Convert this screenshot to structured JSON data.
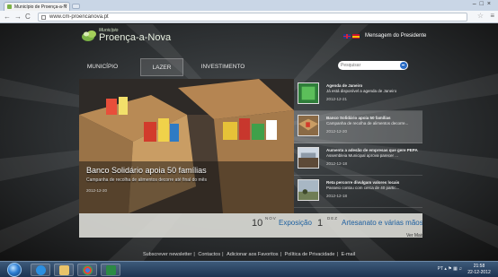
{
  "browser": {
    "tab_title": "Município de Proença-a-N",
    "tab_close": "×",
    "url": "www.cm-proencanova.pt",
    "back": "←",
    "forward": "→",
    "reload": "C"
  },
  "header": {
    "logo_small": "Município",
    "logo_name": "Proença-a-Nova",
    "president_link": "Mensagem do Presidente"
  },
  "nav": [
    {
      "label": "MUNICÍPIO"
    },
    {
      "label": "LAZER"
    },
    {
      "label": "INVESTIMENTO"
    }
  ],
  "search": {
    "placeholder": "Pesquisar"
  },
  "hero": {
    "title": "Banco Solidário apoia 50 famílias",
    "description": "Campanha de recolha de alimentos decorre até final do mês",
    "date": "2012-12-20"
  },
  "news": [
    {
      "title": "Agenda de Janeiro",
      "subtitle": "Já está disponível a agenda de Janeiro",
      "date": "2012-12-21",
      "active": false
    },
    {
      "title": "Banco Solidário apoia 50 famílias",
      "subtitle": "Campanha de recolha de alimentos decorre...",
      "date": "2012-12-20",
      "active": true
    },
    {
      "title": "Aumenta a adesão de empresas que gere PEPA",
      "subtitle": "Assembleia Municipal aprova parecer ...",
      "date": "2012-12-18",
      "active": false
    },
    {
      "title": "Reta percorre divulgam valores locais",
      "subtitle": "Passeio contou com cerca de 40 partic...",
      "date": "2012-12-18",
      "active": false
    }
  ],
  "agenda": [
    {
      "day": "10",
      "month": "NOV",
      "title": "Exposição"
    },
    {
      "day": "1",
      "month": "DEZ",
      "title": "Artesanato e várias mãos"
    }
  ],
  "agenda_more": "Ver Mais",
  "footer": {
    "links": [
      "Subscrever newsletter",
      "Contactos",
      "Adicionar aos Favoritos",
      "Política de Privacidade",
      "E-mail"
    ],
    "separator": "|"
  },
  "taskbar": {
    "lang": "PT",
    "time": "21:58",
    "date": "22-12-2012"
  },
  "colors": {
    "accent": "#1d5fa0",
    "logo_green": "#7bb246"
  }
}
